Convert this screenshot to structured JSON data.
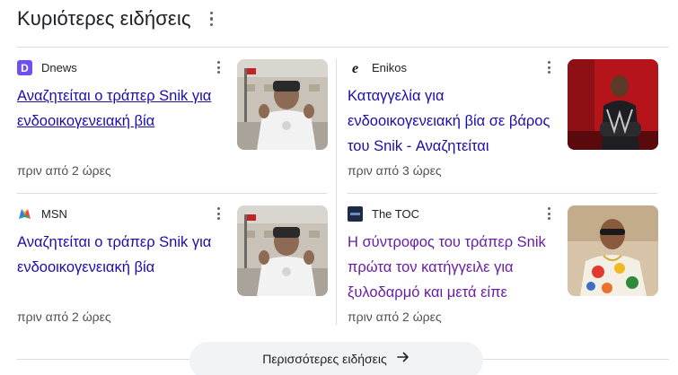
{
  "header": {
    "title": "Κυριότερες ειδήσεις"
  },
  "cards": [
    {
      "source": "Dnews",
      "source_icon": "dnews-logo-icon",
      "title": "Αναζητείται ο τράπερ Snik για ενδοοικογενειακή βία",
      "time": "πριν από 2 ώρες"
    },
    {
      "source": "Enikos",
      "source_icon": "enikos-logo-icon",
      "title": "Καταγγελία για ενδοοικογενειακή βία σε βάρος του Snik - Αναζητείται",
      "time": "πριν από 3 ώρες"
    },
    {
      "source": "MSN",
      "source_icon": "msn-logo-icon",
      "title": "Αναζητείται ο τράπερ Snik για ενδοοικογενειακή βία",
      "time": "πριν από 2 ώρες"
    },
    {
      "source": "The TOC",
      "source_icon": "thetoc-logo-icon",
      "title": "Η σύντροφος του τράπερ Snik πρώτα τον κατήγγειλε για ξυλοδαρμό και μετά είπε",
      "time": "πριν από 2 ώρες"
    }
  ],
  "more_button": {
    "label": "Περισσότερες ειδήσεις"
  },
  "colors": {
    "link": "#1a0dab",
    "visited": "#681da8",
    "meta_text": "#4d5156",
    "divider": "#dadce0"
  }
}
